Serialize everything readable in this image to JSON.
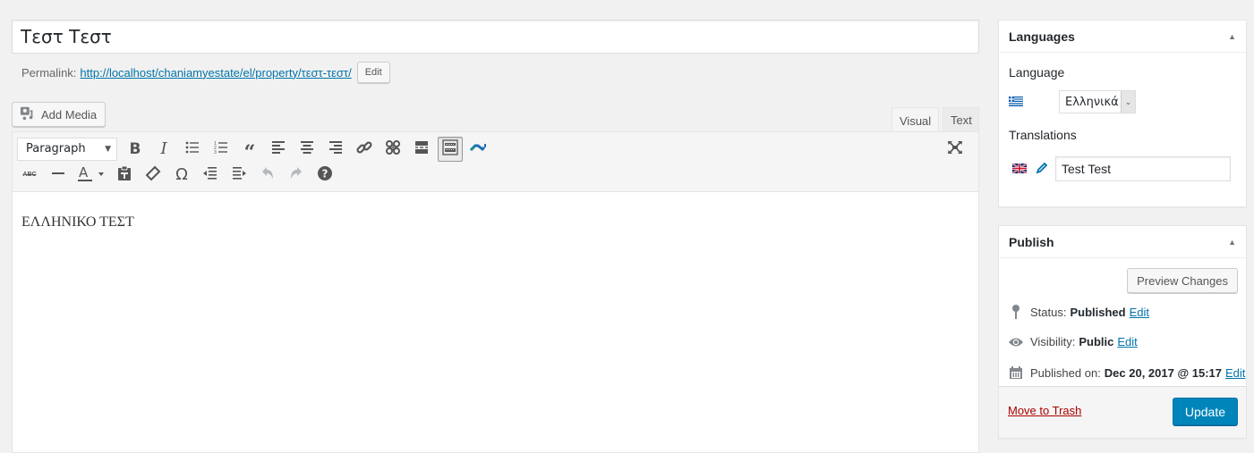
{
  "post": {
    "title": "Τεστ Τεστ",
    "permalink_label": "Permalink:",
    "permalink_url": "http://localhost/chaniamyestate/el/property/τεστ-τεστ/",
    "permalink_edit": "Edit",
    "content": "ΕΛΛΗΝΙΚΟ ΤΕΣΤ"
  },
  "editor": {
    "add_media": "Add Media",
    "tabs": [
      {
        "label": "Visual",
        "active": true
      },
      {
        "label": "Text",
        "active": false
      }
    ],
    "format_select": "Paragraph",
    "toolbar_row1": [
      "bold",
      "italic",
      "bulleted-list",
      "numbered-list",
      "blockquote",
      "align-left",
      "align-center",
      "align-right",
      "insert-link",
      "remove-link",
      "read-more",
      "toolbar-toggle",
      "custom-plugin"
    ],
    "toolbar_row2": [
      "strikethrough",
      "horizontal-line",
      "text-color",
      "paste-as-text",
      "clear-formatting",
      "special-character",
      "decrease-indent",
      "increase-indent",
      "undo",
      "redo",
      "keyboard-shortcuts"
    ]
  },
  "languages": {
    "title": "Languages",
    "language_label": "Language",
    "language_value": "Ελληνικά",
    "translations_label": "Translations",
    "translation_value": "Test Test"
  },
  "publish": {
    "title": "Publish",
    "preview_button": "Preview Changes",
    "status_label": "Status:",
    "status_value": "Published",
    "visibility_label": "Visibility:",
    "visibility_value": "Public",
    "published_on_label": "Published on:",
    "published_on_value": "Dec 20, 2017 @ 15:17",
    "edit_link": "Edit",
    "trash_link": "Move to Trash",
    "update_button": "Update"
  },
  "colors": {
    "primary": "#0085ba",
    "link": "#0073aa",
    "trash": "#aa0000",
    "background": "#f1f1f1"
  }
}
